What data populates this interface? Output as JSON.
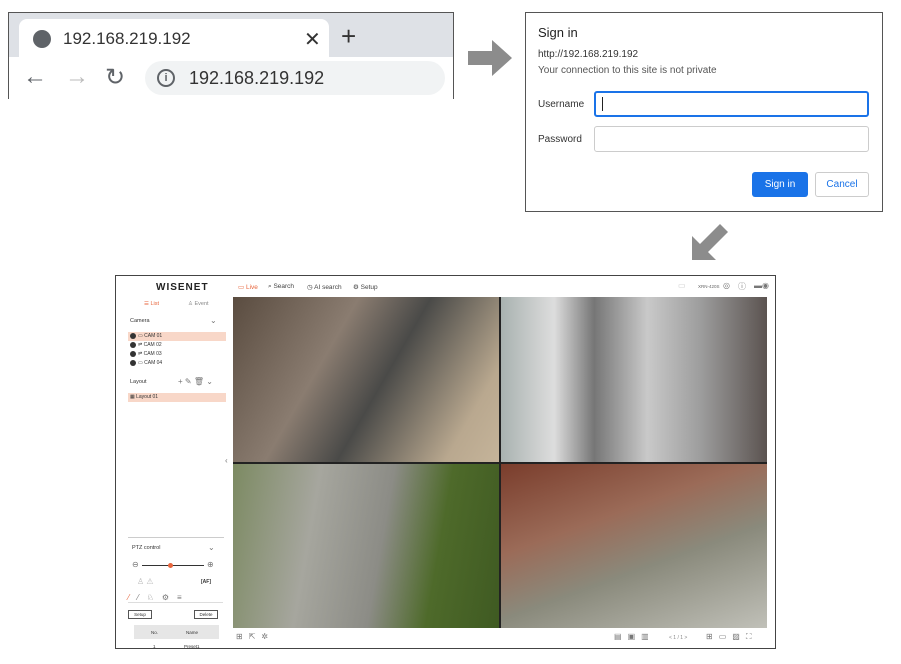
{
  "browser": {
    "tab_title": "192.168.219.192",
    "url": "192.168.219.192",
    "icons": [
      "globe-icon",
      "close-icon",
      "plus-icon",
      "back-icon",
      "forward-icon",
      "reload-icon",
      "info-icon"
    ]
  },
  "signin": {
    "title": "Sign in",
    "url": "http://192.168.219.192",
    "warning": "Your connection to this site is not private",
    "username_label": "Username",
    "username_value": "",
    "password_label": "Password",
    "password_value": "",
    "signin_button": "Sign in",
    "cancel_button": "Cancel",
    "accent": "#1a73e8"
  },
  "viewer": {
    "logo": "WISENET",
    "menu": [
      {
        "label": "Live",
        "active": true
      },
      {
        "label": "Search"
      },
      {
        "label": "AI search"
      },
      {
        "label": "Setup"
      }
    ],
    "model": "XRN-420S",
    "side_tabs": [
      "List",
      "Event"
    ],
    "camera_header": "Camera",
    "cameras": [
      {
        "num": "1",
        "label": "CAM 01",
        "selected": true
      },
      {
        "num": "2",
        "label": "CAM 02"
      },
      {
        "num": "3",
        "label": "CAM 03"
      },
      {
        "num": "4",
        "label": "CAM 04"
      }
    ],
    "layout_header": "Layout",
    "layouts": [
      {
        "label": "Layout 01",
        "selected": true
      }
    ],
    "ptz_header": "PTZ control",
    "ptz_zoom_level": 0.45,
    "af_label": "AF",
    "setup_button": "Setup",
    "delete_button": "Delete",
    "preset_headers": [
      "No.",
      "Name"
    ],
    "presets": [
      {
        "no": "1",
        "name": "Preset1"
      }
    ],
    "pager": "< 1 / 1 >",
    "accent": "#e8663d"
  }
}
